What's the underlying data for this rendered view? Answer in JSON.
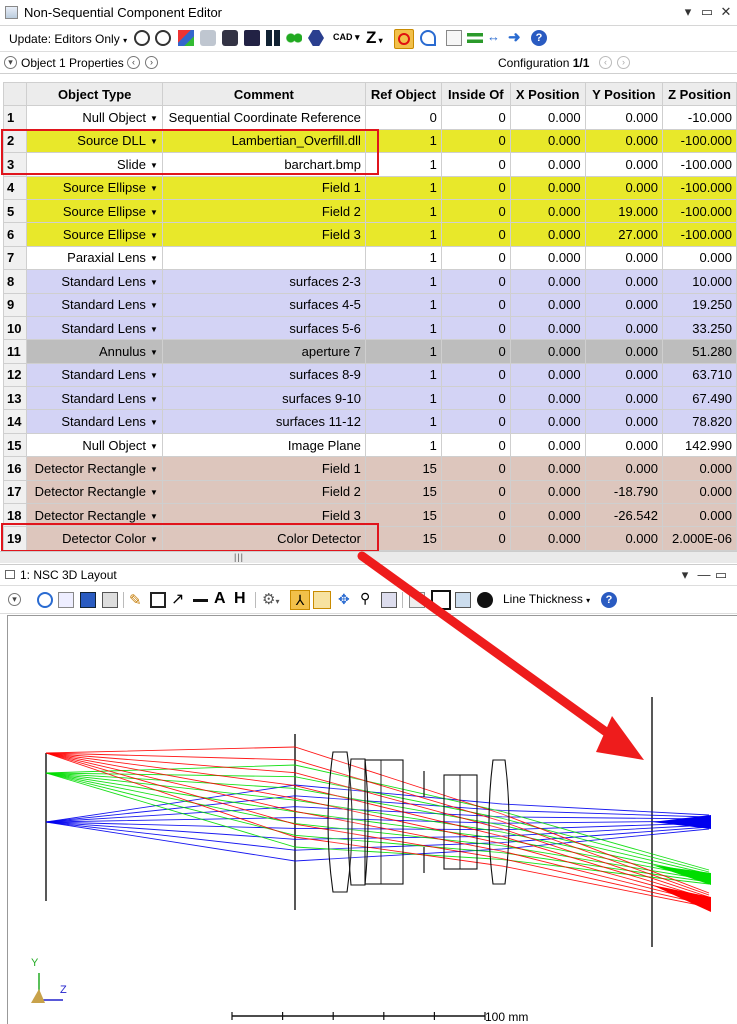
{
  "window": {
    "title": "Non-Sequential Component Editor"
  },
  "toolbar": {
    "update_label": "Update: Editors Only",
    "cad_label": "CAD",
    "z_label": "Z"
  },
  "props": {
    "object_label": "Object 1 Properties",
    "config_label": "Configuration",
    "config_value": "1/1"
  },
  "columns": [
    "Object Type",
    "Comment",
    "Ref Object",
    "Inside Of",
    "X Position",
    "Y Position",
    "Z Position"
  ],
  "rows": [
    {
      "n": "1",
      "type": "Null Object",
      "comment": "Sequential Coordinate Reference",
      "ref": "0",
      "inside": "0",
      "x": "0.000",
      "y": "0.000",
      "z": "-10.000",
      "color": "white"
    },
    {
      "n": "2",
      "type": "Source DLL",
      "comment": "Lambertian_Overfill.dll",
      "ref": "1",
      "inside": "0",
      "x": "0.000",
      "y": "0.000",
      "z": "-100.000",
      "color": "yellow"
    },
    {
      "n": "3",
      "type": "Slide",
      "comment": "barchart.bmp",
      "ref": "1",
      "inside": "0",
      "x": "0.000",
      "y": "0.000",
      "z": "-100.000",
      "color": "white"
    },
    {
      "n": "4",
      "type": "Source Ellipse",
      "comment": "Field 1",
      "ref": "1",
      "inside": "0",
      "x": "0.000",
      "y": "0.000",
      "z": "-100.000",
      "color": "yellow"
    },
    {
      "n": "5",
      "type": "Source Ellipse",
      "comment": "Field 2",
      "ref": "1",
      "inside": "0",
      "x": "0.000",
      "y": "19.000",
      "z": "-100.000",
      "color": "yellow"
    },
    {
      "n": "6",
      "type": "Source Ellipse",
      "comment": "Field 3",
      "ref": "1",
      "inside": "0",
      "x": "0.000",
      "y": "27.000",
      "z": "-100.000",
      "color": "yellow"
    },
    {
      "n": "7",
      "type": "Paraxial Lens",
      "comment": "",
      "ref": "1",
      "inside": "0",
      "x": "0.000",
      "y": "0.000",
      "z": "0.000",
      "color": "white"
    },
    {
      "n": "8",
      "type": "Standard Lens",
      "comment": "surfaces 2-3",
      "ref": "1",
      "inside": "0",
      "x": "0.000",
      "y": "0.000",
      "z": "10.000",
      "color": "lav"
    },
    {
      "n": "9",
      "type": "Standard Lens",
      "comment": "surfaces 4-5",
      "ref": "1",
      "inside": "0",
      "x": "0.000",
      "y": "0.000",
      "z": "19.250",
      "color": "lav"
    },
    {
      "n": "10",
      "type": "Standard Lens",
      "comment": "surfaces 5-6",
      "ref": "1",
      "inside": "0",
      "x": "0.000",
      "y": "0.000",
      "z": "33.250",
      "color": "lav"
    },
    {
      "n": "11",
      "type": "Annulus",
      "comment": "aperture 7",
      "ref": "1",
      "inside": "0",
      "x": "0.000",
      "y": "0.000",
      "z": "51.280",
      "color": "gray"
    },
    {
      "n": "12",
      "type": "Standard Lens",
      "comment": "surfaces 8-9",
      "ref": "1",
      "inside": "0",
      "x": "0.000",
      "y": "0.000",
      "z": "63.710",
      "color": "lav"
    },
    {
      "n": "13",
      "type": "Standard Lens",
      "comment": "surfaces 9-10",
      "ref": "1",
      "inside": "0",
      "x": "0.000",
      "y": "0.000",
      "z": "67.490",
      "color": "lav"
    },
    {
      "n": "14",
      "type": "Standard Lens",
      "comment": "surfaces 11-12",
      "ref": "1",
      "inside": "0",
      "x": "0.000",
      "y": "0.000",
      "z": "78.820",
      "color": "lav"
    },
    {
      "n": "15",
      "type": "Null Object",
      "comment": "Image Plane",
      "ref": "1",
      "inside": "0",
      "x": "0.000",
      "y": "0.000",
      "z": "142.990",
      "color": "white"
    },
    {
      "n": "16",
      "type": "Detector Rectangle",
      "comment": "Field 1",
      "ref": "15",
      "inside": "0",
      "x": "0.000",
      "y": "0.000",
      "z": "0.000",
      "color": "rose"
    },
    {
      "n": "17",
      "type": "Detector Rectangle",
      "comment": "Field 2",
      "ref": "15",
      "inside": "0",
      "x": "0.000",
      "y": "-18.790",
      "z": "0.000",
      "color": "rose"
    },
    {
      "n": "18",
      "type": "Detector Rectangle",
      "comment": "Field 3",
      "ref": "15",
      "inside": "0",
      "x": "0.000",
      "y": "-26.542",
      "z": "0.000",
      "color": "rose"
    },
    {
      "n": "19",
      "type": "Detector Color",
      "comment": "Color Detector",
      "ref": "15",
      "inside": "0",
      "x": "0.000",
      "y": "0.000",
      "z": "2.000E-06",
      "color": "rose"
    }
  ],
  "layout_panel": {
    "title": "1: NSC 3D Layout",
    "line_thickness_label": "Line Thickness",
    "scale_label": "100 mm",
    "axis_y": "Y",
    "axis_z": "Z"
  },
  "colors": {
    "yellow": "#e8e82a",
    "lavender": "#d3d3f5",
    "gray": "#bdbdbd",
    "rose": "#ddc6bd",
    "highlight": "#e0141c",
    "ray_red": "#ff0000",
    "ray_green": "#00dd00",
    "ray_blue": "#0000ee"
  }
}
